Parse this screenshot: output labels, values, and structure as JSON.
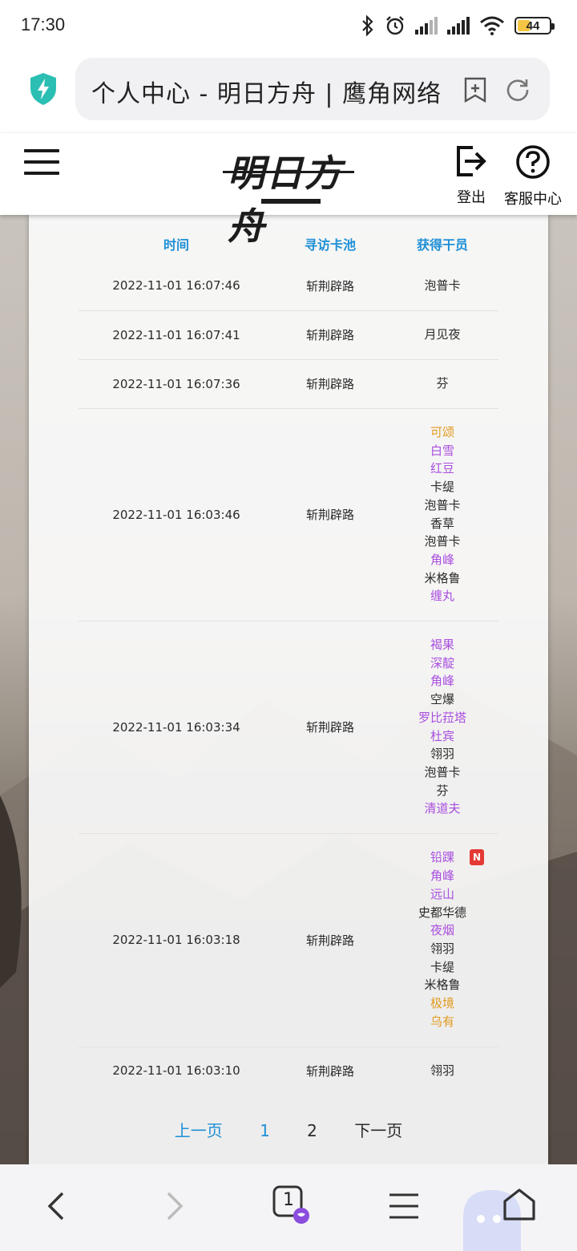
{
  "status_bar": {
    "time": "17:30",
    "battery": "44"
  },
  "browser": {
    "tab_title": "个人中心 - 明日方舟 | 鹰角网络"
  },
  "site_header": {
    "logo_text": "明日方舟",
    "logout_label": "登出",
    "help_label": "客服中心"
  },
  "table": {
    "headers": {
      "time": "时间",
      "pool": "寻访卡池",
      "operator": "获得干员"
    },
    "rows": [
      {
        "time": "2022-11-01 16:07:46",
        "pool": "斩荆辟路",
        "operators": [
          {
            "name": "泡普卡",
            "rarity": "3"
          }
        ]
      },
      {
        "time": "2022-11-01 16:07:41",
        "pool": "斩荆辟路",
        "operators": [
          {
            "name": "月见夜",
            "rarity": "3"
          }
        ]
      },
      {
        "time": "2022-11-01 16:07:36",
        "pool": "斩荆辟路",
        "operators": [
          {
            "name": "芬",
            "rarity": "3"
          }
        ]
      },
      {
        "time": "2022-11-01 16:03:46",
        "pool": "斩荆辟路",
        "operators": [
          {
            "name": "可颂",
            "rarity": "5"
          },
          {
            "name": "白雪",
            "rarity": "4"
          },
          {
            "name": "红豆",
            "rarity": "4"
          },
          {
            "name": "卡缇",
            "rarity": "3"
          },
          {
            "name": "泡普卡",
            "rarity": "3"
          },
          {
            "name": "香草",
            "rarity": "3"
          },
          {
            "name": "泡普卡",
            "rarity": "3"
          },
          {
            "name": "角峰",
            "rarity": "4"
          },
          {
            "name": "米格鲁",
            "rarity": "3"
          },
          {
            "name": "缠丸",
            "rarity": "4"
          }
        ]
      },
      {
        "time": "2022-11-01 16:03:34",
        "pool": "斩荆辟路",
        "operators": [
          {
            "name": "褐果",
            "rarity": "4"
          },
          {
            "name": "深靛",
            "rarity": "4"
          },
          {
            "name": "角峰",
            "rarity": "4"
          },
          {
            "name": "空爆",
            "rarity": "3"
          },
          {
            "name": "罗比菈塔",
            "rarity": "4"
          },
          {
            "name": "杜宾",
            "rarity": "4"
          },
          {
            "name": "翎羽",
            "rarity": "3"
          },
          {
            "name": "泡普卡",
            "rarity": "3"
          },
          {
            "name": "芬",
            "rarity": "3"
          },
          {
            "name": "清道夫",
            "rarity": "4"
          }
        ]
      },
      {
        "time": "2022-11-01 16:03:18",
        "pool": "斩荆辟路",
        "operators": [
          {
            "name": "铅踝",
            "rarity": "4",
            "badge": "N"
          },
          {
            "name": "角峰",
            "rarity": "4"
          },
          {
            "name": "远山",
            "rarity": "4"
          },
          {
            "name": "史都华德",
            "rarity": "3"
          },
          {
            "name": "夜烟",
            "rarity": "4"
          },
          {
            "name": "翎羽",
            "rarity": "3"
          },
          {
            "name": "卡缇",
            "rarity": "3"
          },
          {
            "name": "米格鲁",
            "rarity": "3"
          },
          {
            "name": "极境",
            "rarity": "5"
          },
          {
            "name": "乌有",
            "rarity": "5"
          }
        ]
      },
      {
        "time": "2022-11-01 16:03:10",
        "pool": "斩荆辟路",
        "operators": [
          {
            "name": "翎羽",
            "rarity": "3"
          }
        ]
      }
    ]
  },
  "pagination": {
    "prev": "上一页",
    "pages": [
      "1",
      "2"
    ],
    "current": "2",
    "next": "下一页"
  },
  "bottom_nav": {
    "tab_count": "1"
  },
  "colors": {
    "header_link": "#1d8fd6",
    "rarity_4": "#a94fdf",
    "rarity_5": "#e09a1f",
    "badge": "#e53935"
  }
}
